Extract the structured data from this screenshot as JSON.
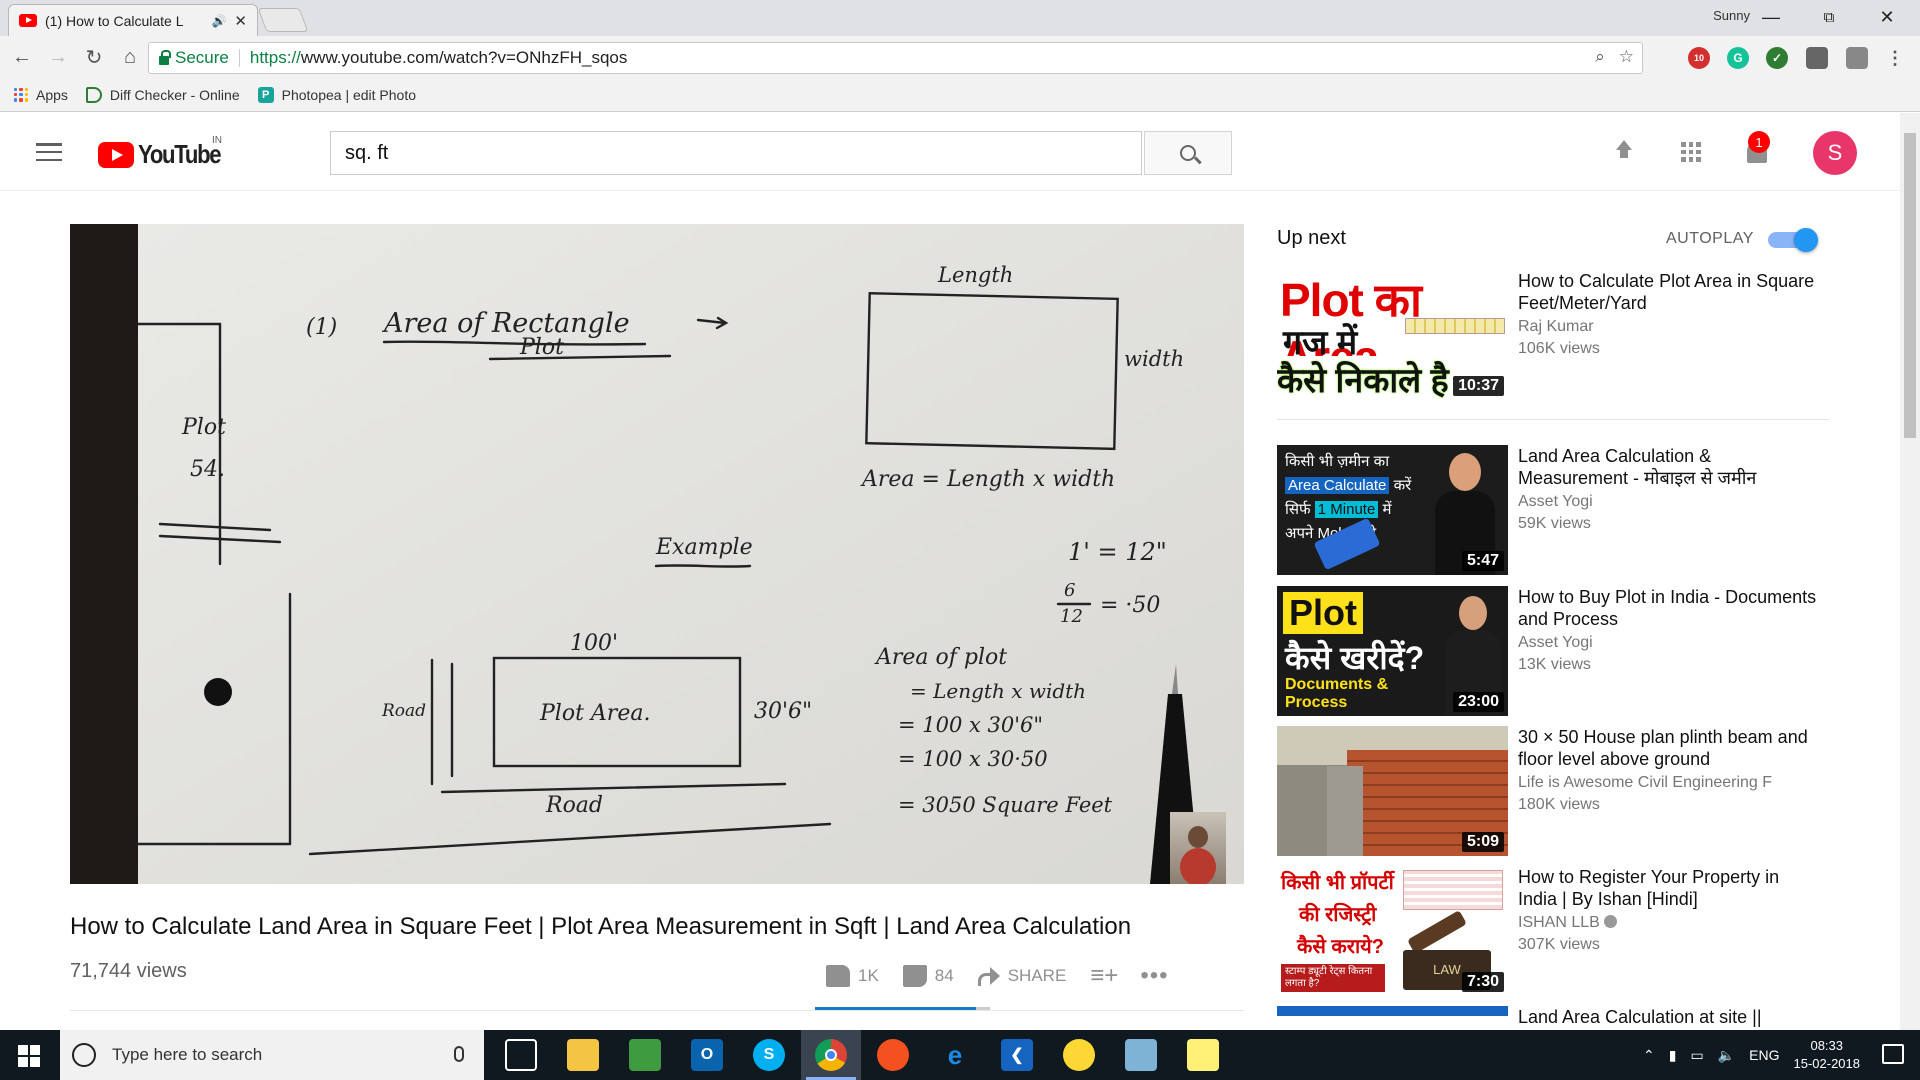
{
  "browser": {
    "tab_title": "(1) How to Calculate L",
    "user_name": "Sunny",
    "secure_label": "Secure",
    "url_scheme": "https://",
    "url_rest": "www.youtube.com/watch?v=ONhzFH_sqos",
    "extension_badge": "10",
    "bookmarks": [
      {
        "label": "Apps",
        "icon": "apps-grid-icon"
      },
      {
        "label": "Diff Checker - Online",
        "icon": "diffchecker-icon"
      },
      {
        "label": "Photopea | edit Photo",
        "icon": "photopea-icon"
      }
    ]
  },
  "youtube": {
    "logo_text": "YouTube",
    "country": "IN",
    "search_value": "sq. ft",
    "notification_count": "1",
    "avatar_letter": "S"
  },
  "video": {
    "title": "How to Calculate Land Area in Square Feet | Plot Area Measurement in Sqft | Land Area Calculation",
    "views": "71,744 views",
    "likes": "1K",
    "dislikes": "84",
    "share_label": "SHARE",
    "like_ratio": 0.92,
    "whiteboard": {
      "heading_num": "1",
      "heading": "Area of Rectangle",
      "heading_sub": "Plot",
      "side_label": "Plot",
      "side_num": "54.",
      "length": "Length",
      "width": "width",
      "formula": "Area = Length x width",
      "example": "Example",
      "conv1": "1' = 12\"",
      "conv2_num": "6",
      "conv2_den": "12",
      "conv2_val": "= ·50",
      "top_dim": "100'",
      "plot_label": "Plot Area.",
      "side_dim": "30'6\"",
      "road_left": "Road",
      "road_bottom": "Road",
      "calc_title": "Area of plot",
      "calc1": "= Length x width",
      "calc2": "= 100 x 30'6\"",
      "calc3": "= 100 x 30·50",
      "calc4": "= 3050 Square Feet"
    }
  },
  "upnext": {
    "label": "Up next",
    "autoplay_label": "AUTOPLAY",
    "autoplay_on": true,
    "items": [
      {
        "title": "How to Calculate Plot Area in Square Feet/Meter/Yard",
        "channel": "Raj Kumar",
        "views": "106K views",
        "duration": "10:37",
        "thumb_text": [
          "Plot का Area",
          "गज में",
          "कैसे निकाले है"
        ]
      },
      {
        "title": "Land Area Calculation & Measurement - मोबाइल से जमीन",
        "channel": "Asset Yogi",
        "views": "59K views",
        "duration": "5:47",
        "thumb_text": [
          "किसी भी ज़मीन का",
          "Area Calculate",
          "करें",
          "सिर्फ",
          "1 Minute",
          "में",
          "अपने Mobile से"
        ]
      },
      {
        "title": "How to Buy Plot in India - Documents and Process",
        "channel": "Asset Yogi",
        "views": "13K views",
        "duration": "23:00",
        "thumb_text": [
          "Plot",
          "कैसे खरीदें?",
          "Documents &",
          "Process"
        ]
      },
      {
        "title": "30 × 50 House plan plinth beam and floor level above ground",
        "channel": "Life is Awesome Civil Engineering F",
        "views": "180K views",
        "duration": "5:09"
      },
      {
        "title": "How to Register Your Property in India | By Ishan [Hindi]",
        "channel": "ISHAN LLB",
        "views": "307K views",
        "duration": "7:30",
        "thumb_text": [
          "किसी भी प्रॉपर्टी",
          "की रजिस्ट्री",
          "कैसे कराये?",
          "स्टाम्प ड्यूटी रेट्स कितना लगता है?",
          "LAW"
        ]
      },
      {
        "title": "Land Area Calculation at site ||"
      }
    ]
  },
  "taskbar": {
    "search_placeholder": "Type here to search",
    "language": "ENG",
    "time": "08:33",
    "date": "15-02-2018",
    "apps": [
      "file-explorer",
      "excel-like",
      "outlook",
      "skype",
      "chrome",
      "pen-app",
      "edge",
      "vscode",
      "lightbulb-app",
      "notes-app",
      "sticky-notes"
    ]
  }
}
